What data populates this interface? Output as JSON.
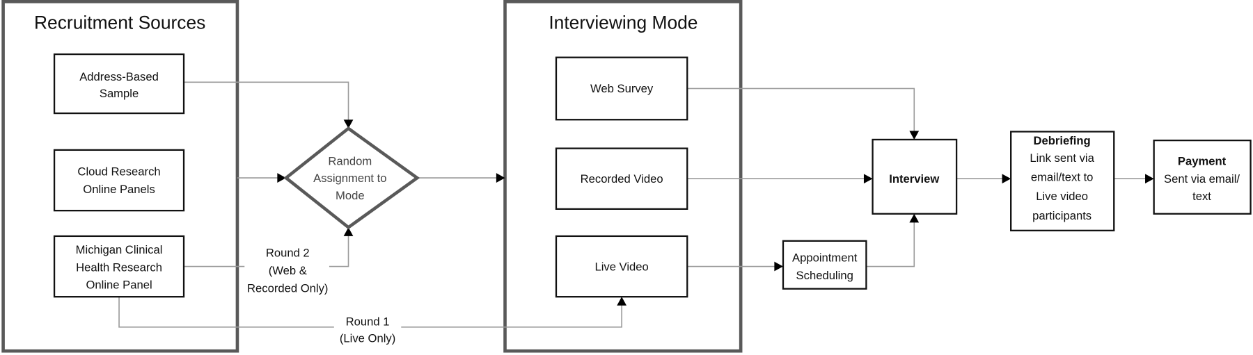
{
  "groups": {
    "recruitment": {
      "title": "Recruitment Sources"
    },
    "interviewing": {
      "title": "Interviewing Mode"
    }
  },
  "nodes": {
    "address": [
      "Address-Based",
      "Sample"
    ],
    "cloud": [
      "Cloud Research",
      "Online Panels"
    ],
    "michigan": [
      "Michigan Clinical",
      "Health Research",
      "Online Panel"
    ],
    "random": [
      "Random",
      "Assignment to",
      "Mode"
    ],
    "web": [
      "Web Survey"
    ],
    "recorded": [
      "Recorded Video"
    ],
    "live": [
      "Live Video"
    ],
    "appointment": [
      "Appointment",
      "Scheduling"
    ],
    "interview": {
      "title": "Interview"
    },
    "debriefing": {
      "title": "Debriefing",
      "lines": [
        "Link sent via",
        "email/text to",
        "Live video",
        "participants"
      ]
    },
    "payment": {
      "title": "Payment",
      "lines": [
        "Sent via email/",
        "text"
      ]
    }
  },
  "edge_labels": {
    "round2": [
      "Round 2",
      "(Web &",
      "Recorded Only)"
    ],
    "round1": [
      "Round 1",
      "(Live Only)"
    ]
  },
  "colors": {
    "frame": "#595959",
    "connector": "#9a9a9a",
    "box_border": "#111111"
  }
}
